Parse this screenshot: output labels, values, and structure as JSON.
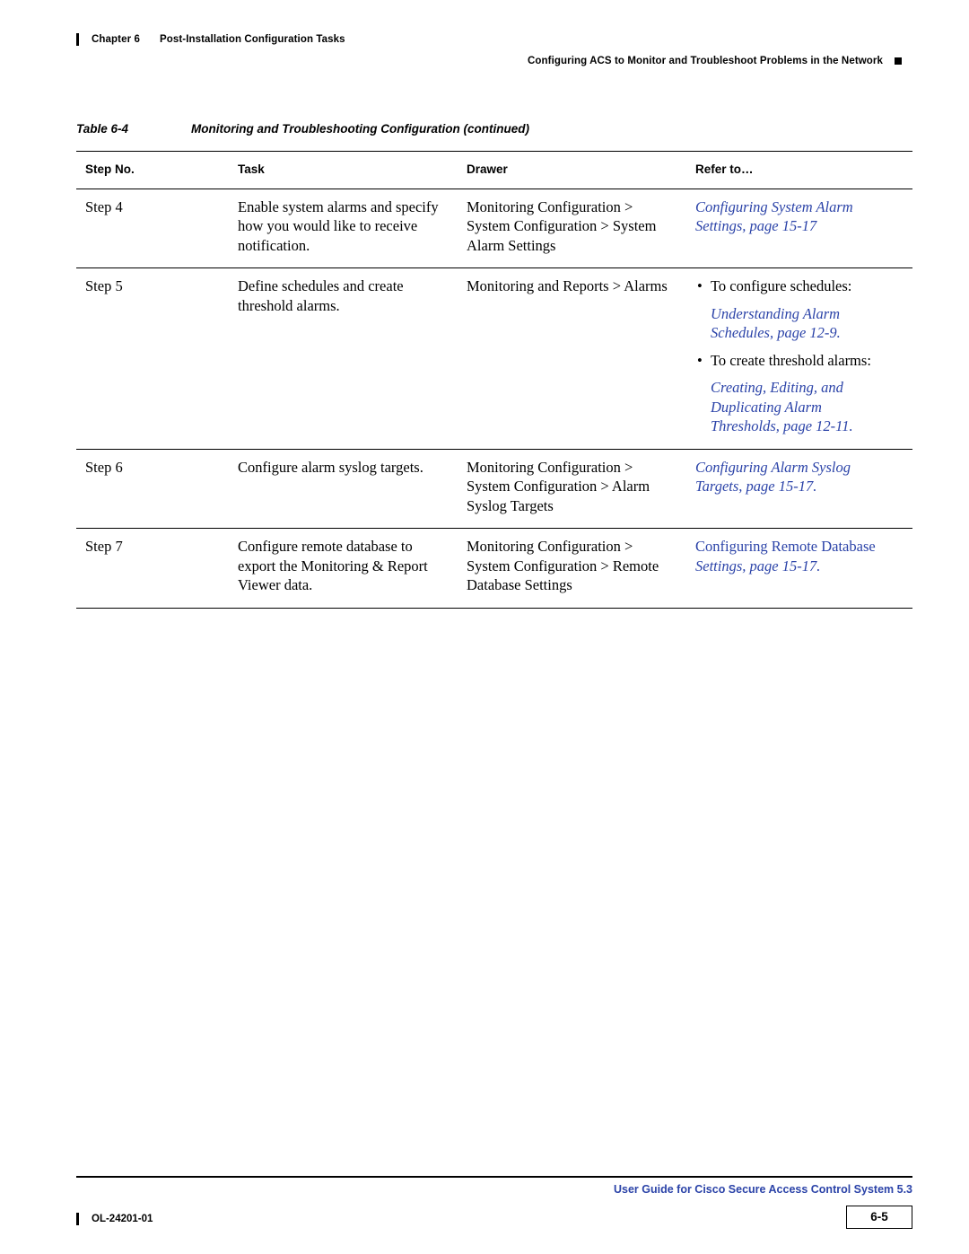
{
  "header": {
    "chapter_num": "Chapter 6",
    "chapter_title": "Post-Installation Configuration Tasks",
    "running_head": "Configuring ACS to Monitor and Troubleshoot Problems in the Network"
  },
  "caption": {
    "label": "Table 6-4",
    "text": "Monitoring and Troubleshooting Configuration (continued)"
  },
  "table": {
    "headers": {
      "step": "Step No.",
      "task": "Task",
      "drawer": "Drawer",
      "refer": "Refer to…"
    },
    "rows": [
      {
        "step": "Step 4",
        "task": "Enable system alarms and specify how you would like to receive notification.",
        "drawer": "Monitoring Configuration > System Configuration > System Alarm Settings",
        "refer_link_1": "Configuring System Alarm",
        "refer_link_2": "Settings, page 15-17"
      },
      {
        "step": "Step 5",
        "task": "Define schedules and create threshold alarms.",
        "drawer": "Monitoring and Reports > Alarms",
        "bullet_1": "To configure schedules:",
        "bullet_1_link_1": "Understanding Alarm",
        "bullet_1_link_2": "Schedules, page 12-9.",
        "bullet_2": "To create threshold alarms:",
        "bullet_2_link_1": "Creating, Editing, and",
        "bullet_2_link_2": "Duplicating Alarm",
        "bullet_2_link_3": "Thresholds, page 12-11."
      },
      {
        "step": "Step 6",
        "task": "Configure alarm syslog targets.",
        "drawer": "Monitoring Configuration > System Configuration > Alarm Syslog Targets",
        "refer_link_1": "Configuring Alarm Syslog",
        "refer_link_2": "Targets, page 15-17."
      },
      {
        "step": "Step 7",
        "task": "Configure remote database to export the Monitoring & Report Viewer data.",
        "drawer": "Monitoring Configuration > System Configuration > Remote Database Settings",
        "refer_link_1": "Configuring Remote Database",
        "refer_link_2": "Settings, page 15-17."
      }
    ]
  },
  "footer": {
    "doc_title": "User Guide for Cisco Secure Access Control System 5.3",
    "doc_number": "OL-24201-01",
    "page_number": "6-5"
  }
}
